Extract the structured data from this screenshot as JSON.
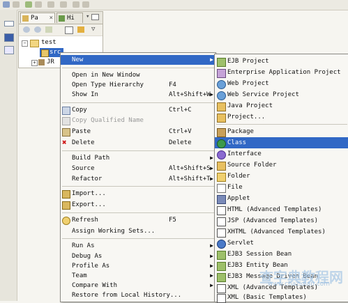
{
  "explorer": {
    "tabs": [
      {
        "label": "Pa",
        "close": "×"
      },
      {
        "label": "Hi"
      }
    ],
    "tree": [
      {
        "label": "test",
        "expander": "−"
      },
      {
        "label": "src"
      },
      {
        "label": "JR",
        "expander": "+"
      }
    ]
  },
  "context_menu": {
    "items": [
      {
        "label": "New",
        "submenu": true,
        "selected": true
      },
      {
        "label": "Open in New Window"
      },
      {
        "label": "Open Type Hierarchy",
        "shortcut": "F4"
      },
      {
        "label": "Show In",
        "shortcut": "Alt+Shift+W",
        "submenu": true
      },
      {
        "label": "Copy",
        "shortcut": "Ctrl+C",
        "icon": "copy-icon"
      },
      {
        "label": "Copy Qualified Name",
        "disabled": true,
        "icon": "copy-qualified-icon"
      },
      {
        "label": "Paste",
        "shortcut": "Ctrl+V",
        "icon": "paste-icon"
      },
      {
        "label": "Delete",
        "shortcut": "Delete",
        "icon": "delete-icon"
      },
      {
        "label": "Build Path",
        "submenu": true
      },
      {
        "label": "Source",
        "shortcut": "Alt+Shift+S",
        "submenu": true
      },
      {
        "label": "Refactor",
        "shortcut": "Alt+Shift+T",
        "submenu": true
      },
      {
        "label": "Import...",
        "icon": "import-icon"
      },
      {
        "label": "Export...",
        "icon": "export-icon"
      },
      {
        "label": "Refresh",
        "shortcut": "F5",
        "icon": "refresh-icon"
      },
      {
        "label": "Assign Working Sets..."
      },
      {
        "label": "Run As",
        "submenu": true
      },
      {
        "label": "Debug As",
        "submenu": true
      },
      {
        "label": "Profile As",
        "submenu": true
      },
      {
        "label": "Team",
        "submenu": true
      },
      {
        "label": "Compare With",
        "submenu": true
      },
      {
        "label": "Restore from Local History..."
      }
    ]
  },
  "new_submenu": {
    "items": [
      {
        "label": "EJB Project",
        "icon": "ejb-project-icon"
      },
      {
        "label": "Enterprise Application Project",
        "icon": "ear-project-icon"
      },
      {
        "label": "Web Project",
        "icon": "web-project-icon"
      },
      {
        "label": "Web Service Project",
        "icon": "web-service-project-icon"
      },
      {
        "label": "Java Project",
        "icon": "java-project-icon"
      },
      {
        "label": "Project...",
        "icon": "project-icon"
      },
      {
        "label": "Package",
        "icon": "package-icon"
      },
      {
        "label": "Class",
        "icon": "class-icon",
        "selected": true
      },
      {
        "label": "Interface",
        "icon": "interface-icon"
      },
      {
        "label": "Source Folder",
        "icon": "source-folder-icon"
      },
      {
        "label": "Folder",
        "icon": "folder-icon"
      },
      {
        "label": "File",
        "icon": "file-icon"
      },
      {
        "label": "Applet",
        "icon": "applet-icon"
      },
      {
        "label": "HTML (Advanced Templates)",
        "icon": "html-icon"
      },
      {
        "label": "JSP (Advanced Templates)",
        "icon": "jsp-icon"
      },
      {
        "label": "XHTML (Advanced Templates)",
        "icon": "xhtml-icon"
      },
      {
        "label": "Servlet",
        "icon": "servlet-icon"
      },
      {
        "label": "EJB3 Session Bean",
        "icon": "session-bean-icon"
      },
      {
        "label": "EJB3 Entity Bean",
        "icon": "entity-bean-icon"
      },
      {
        "label": "EJB3 Message Driven Bean",
        "icon": "message-bean-icon"
      },
      {
        "label": "XML (Advanced Templates)",
        "icon": "xml-advanced-icon"
      },
      {
        "label": "XML (Basic Templates)",
        "icon": "xml-basic-icon"
      }
    ]
  },
  "watermark": {
    "text": "查字典教程网",
    "subtext": "www.chazidian.com"
  },
  "colors": {
    "selection": "#3168c5",
    "menu_bg": "#f8f7f3"
  }
}
